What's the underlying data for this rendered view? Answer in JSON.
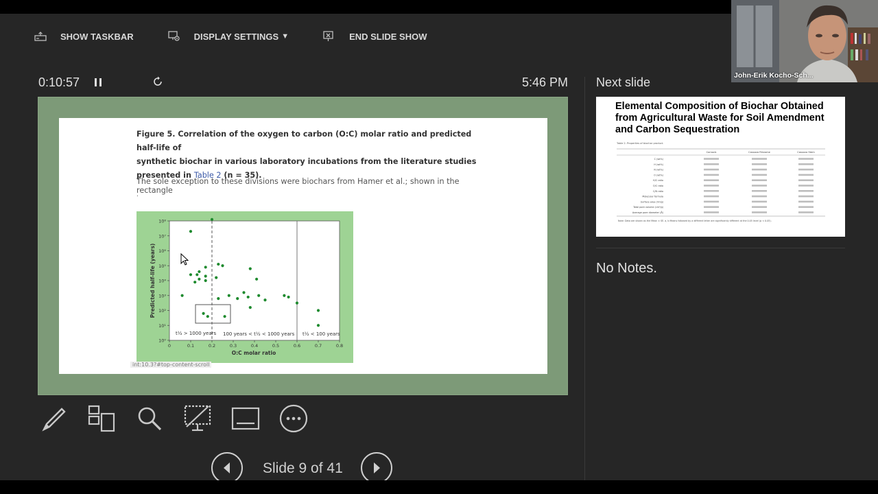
{
  "toolbar": {
    "show_taskbar": "SHOW TASKBAR",
    "display_settings": "DISPLAY SETTINGS",
    "end_slide_show": "END SLIDE SHOW"
  },
  "presenter": {
    "timer": "0:10:57",
    "clock": "5:46 PM",
    "slide_counter": "Slide 9 of 41",
    "next_slide_label": "Next slide",
    "notes_text": "No Notes.",
    "webcam_name": "John-Erik Kocho-Sch..."
  },
  "current_slide": {
    "caption_line1": "Figure 5.  Correlation of the oxygen to carbon (O:C) molar ratio and predicted half-life of",
    "caption_line2": "synthetic biochar in various laboratory incubations from the literature studies",
    "caption_line3_pre": "presented in ",
    "caption_link": "Table 2",
    "caption_line3_post": " (n = 35).",
    "note": "The sole exception to these divisions were biochars from Hamer et al.; shown in the rectangle",
    "note_dot": ".",
    "url_tip": "int:10.3?#top-content-scroll"
  },
  "chart_data": {
    "type": "scatter",
    "xlabel": "O:C molar ratio",
    "ylabel": "Predicted half-life (years)",
    "xlim": [
      0,
      0.8
    ],
    "x_ticks": [
      "0",
      "0.1",
      "0.2",
      "0.3",
      "0.4",
      "0.5",
      "0.6",
      "0.7",
      "0.8"
    ],
    "y_ticks": [
      "10⁰",
      "10¹",
      "10²",
      "10³",
      "10⁴",
      "10⁵",
      "10⁶",
      "10⁷",
      "10⁸"
    ],
    "y_scale": "log",
    "region_labels": [
      "t½ > 1000 years",
      "100 years < t½ < 1000 years",
      "t½ < 100 years"
    ],
    "points": [
      [
        0.06,
        3.0
      ],
      [
        0.1,
        7.3
      ],
      [
        0.1,
        4.4
      ],
      [
        0.12,
        3.9
      ],
      [
        0.13,
        4.4
      ],
      [
        0.14,
        4.6
      ],
      [
        0.14,
        4.1
      ],
      [
        0.17,
        4.9
      ],
      [
        0.17,
        4.0
      ],
      [
        0.17,
        4.3
      ],
      [
        0.2,
        8.1
      ],
      [
        0.22,
        4.2
      ],
      [
        0.23,
        5.1
      ],
      [
        0.25,
        5.0
      ],
      [
        0.23,
        2.8
      ],
      [
        0.28,
        3.0
      ],
      [
        0.32,
        2.8
      ],
      [
        0.35,
        3.2
      ],
      [
        0.37,
        2.9
      ],
      [
        0.38,
        4.8
      ],
      [
        0.41,
        4.1
      ],
      [
        0.42,
        3.0
      ],
      [
        0.45,
        2.7
      ],
      [
        0.54,
        3.0
      ],
      [
        0.56,
        2.9
      ],
      [
        0.6,
        2.5
      ],
      [
        0.7,
        2.0
      ],
      [
        0.7,
        1.0
      ],
      [
        0.16,
        1.8
      ],
      [
        0.18,
        1.6
      ],
      [
        0.26,
        1.6
      ],
      [
        0.38,
        2.2
      ]
    ]
  },
  "next_slide": {
    "title": "Elemental Composition of Biochar Obtained from Agricultural Waste for Soil Amendment and Carbon Sequestration",
    "table_caption": "Table 2. Properties of biochar product.",
    "columns": [
      "Cornocb",
      "Cassava Rhizome",
      "Cassava Stem"
    ],
    "rows": [
      "C (wt%)",
      "H (wt%)",
      "N (wt%)",
      "O (wt%)",
      "H/C ratio",
      "O/C ratio",
      "C/N ratio",
      "Molecular formula",
      "Surface area (m²/g)",
      "Total pore volume (cm³/g)",
      "Average pore diameter (Å)"
    ],
    "footnote": "Note: Data are shown as the Mean ± SE. a, b Means followed by a different letter are significantly different at the 0.05 level (p < 0.05)."
  }
}
